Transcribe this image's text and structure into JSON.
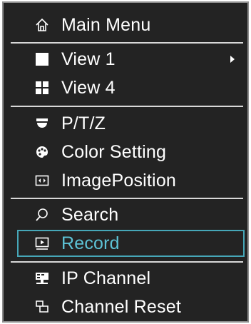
{
  "menu": {
    "items": [
      {
        "label": "Main Menu",
        "icon": "home-icon"
      },
      {
        "label": "View 1",
        "icon": "single-view-icon",
        "has_submenu": true
      },
      {
        "label": "View 4",
        "icon": "quad-view-icon"
      },
      {
        "label": "P/T/Z",
        "icon": "ptz-camera-icon"
      },
      {
        "label": "Color Setting",
        "icon": "palette-icon"
      },
      {
        "label": "ImagePosition",
        "icon": "image-position-icon"
      },
      {
        "label": "Search",
        "icon": "search-icon"
      },
      {
        "label": "Record",
        "icon": "record-icon",
        "selected": true
      },
      {
        "label": "IP Channel",
        "icon": "ip-channel-icon"
      },
      {
        "label": "Channel Reset",
        "icon": "channel-reset-icon"
      }
    ],
    "colors": {
      "background": "#232323",
      "text": "#ffffff",
      "selected_text": "#5dc3d6",
      "selected_border": "#46a7b8",
      "divider": "#d8d8d8"
    }
  }
}
